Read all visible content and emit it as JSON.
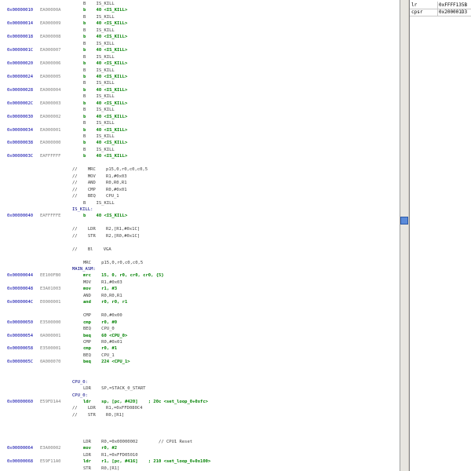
{
  "registers": [
    {
      "name": "lr",
      "value": "0xFFFF135B"
    },
    {
      "name": "cpsr",
      "value": "0x200001D3"
    }
  ],
  "lines": [
    {
      "row": 0,
      "text": "B    IS_KILL"
    },
    {
      "row": 1,
      "addr": "0x00000010",
      "op": "EA00000A",
      "text": "b    40 <IS_KILL>",
      "hl": true
    },
    {
      "row": 2,
      "text": "B    IS_KILL"
    },
    {
      "row": 3,
      "addr": "0x00000014",
      "op": "EA000009",
      "text": "b    40 <IS_KILL>",
      "hl": true
    },
    {
      "row": 4,
      "text": "B    IS_KILL"
    },
    {
      "row": 5,
      "addr": "0x00000018",
      "op": "EA000008",
      "text": "b    40 <IS_KILL>",
      "hl": true
    },
    {
      "row": 6,
      "text": "B    IS_KILL"
    },
    {
      "row": 7,
      "addr": "0x0000001C",
      "op": "EA000007",
      "text": "b    40 <IS_KILL>",
      "hl": true
    },
    {
      "row": 8,
      "text": "B    IS_KILL"
    },
    {
      "row": 9,
      "addr": "0x00000020",
      "op": "EA000006",
      "text": "b    40 <IS_KILL>",
      "hl": true
    },
    {
      "row": 10,
      "text": "B    IS_KILL"
    },
    {
      "row": 11,
      "addr": "0x00000024",
      "op": "EA000005",
      "text": "b    40 <IS_KILL>",
      "hl": true
    },
    {
      "row": 12,
      "text": "B    IS_KILL"
    },
    {
      "row": 13,
      "addr": "0x00000028",
      "op": "EA000004",
      "text": "b    40 <IS_KILL>",
      "hl": true
    },
    {
      "row": 14,
      "text": "B    IS_KILL"
    },
    {
      "row": 15,
      "addr": "0x0000002C",
      "op": "EA000003",
      "text": "b    40 <IS_KILL>",
      "hl": true
    },
    {
      "row": 16,
      "text": "B    IS_KILL"
    },
    {
      "row": 17,
      "addr": "0x00000030",
      "op": "EA000002",
      "text": "b    40 <IS_KILL>",
      "hl": true
    },
    {
      "row": 18,
      "text": "B    IS_KILL"
    },
    {
      "row": 19,
      "addr": "0x00000034",
      "op": "EA000001",
      "text": "b    40 <IS_KILL>",
      "hl": true
    },
    {
      "row": 20,
      "text": "B    IS_KILL"
    },
    {
      "row": 21,
      "addr": "0x00000038",
      "op": "EA000000",
      "text": "b    40 <IS_KILL>",
      "hl": true
    },
    {
      "row": 22,
      "text": "B    IS_KILL"
    },
    {
      "row": 23,
      "addr": "0x0000003C",
      "op": "EAFFFFFF",
      "text": "b    40 <IS_KILL>",
      "hl": true
    },
    {
      "row": 25,
      "text": "//    MRC    p15,0,r0,c0,c0,5",
      "ind": -1
    },
    {
      "row": 26,
      "text": "//    MOV    R1,#0x03",
      "ind": -1
    },
    {
      "row": 27,
      "text": "//    AND    R0,R0,R1",
      "ind": -1
    },
    {
      "row": 28,
      "text": "//    CMP    R0,#0x01",
      "ind": -1
    },
    {
      "row": 29,
      "text": "//    BEQ    CPU_1",
      "ind": -1
    },
    {
      "row": 30,
      "text": "B    IS_KILL"
    },
    {
      "row": 31,
      "text": "IS_KILL:",
      "lbl": true,
      "ind": -2
    },
    {
      "row": 32,
      "addr": "0x00000040",
      "op": "EAFFFFFE",
      "text": "b    40 <IS_KILL>",
      "hl": true
    },
    {
      "row": 34,
      "text": "//    LDR    R2,[R1,#0x1C]",
      "ind": -1
    },
    {
      "row": 35,
      "text": "//    STR    R2,[R0,#0x1C]",
      "ind": -1
    },
    {
      "row": 37,
      "text": "//    Bl    VGA",
      "ind": -1
    },
    {
      "row": 39,
      "text": "MRC    p15,0,r0,c0,c0,5"
    },
    {
      "row": 40,
      "text": "MAIN_ASM:",
      "lbl": true,
      "ind": -2
    },
    {
      "row": 41,
      "addr": "0x00000044",
      "op": "EE100FB0",
      "text": "mrc    15, 0, r0, cr0, cr0, {5}",
      "hl": true
    },
    {
      "row": 42,
      "text": "MOV    R1,#0x03"
    },
    {
      "row": 43,
      "addr": "0x00000048",
      "op": "E3A01003",
      "text": "mov    r1, #3",
      "hl": true
    },
    {
      "row": 44,
      "text": "AND    R0,R0,R1"
    },
    {
      "row": 45,
      "addr": "0x0000004C",
      "op": "E0000001",
      "text": "and    r0, r0, r1",
      "hl": true
    },
    {
      "row": 47,
      "text": "CMP    R0,#0x00"
    },
    {
      "row": 48,
      "addr": "0x00000050",
      "op": "E3500000",
      "text": "cmp    r0, #0",
      "hl": true
    },
    {
      "row": 49,
      "text": "BEQ    CPU_0"
    },
    {
      "row": 50,
      "addr": "0x00000054",
      "op": "0A000001",
      "text": "beq    60 <CPU_0>",
      "hl": true
    },
    {
      "row": 51,
      "text": "CMP    R0,#0x01"
    },
    {
      "row": 52,
      "addr": "0x00000058",
      "op": "E3500001",
      "text": "cmp    r0, #1",
      "hl": true
    },
    {
      "row": 53,
      "text": "BEQ    CPU_1"
    },
    {
      "row": 54,
      "addr": "0x0000005C",
      "op": "0A000070",
      "text": "beq    224 <CPU_1>",
      "hl": true
    },
    {
      "row": 57,
      "text": "CPU_0:",
      "lbl": true,
      "ind": -2
    },
    {
      "row": 58,
      "text": "LDR    SP,=STACK_0_START"
    },
    {
      "row": 59,
      "text": "CPU_0:",
      "lbl": true,
      "ind": -2
    },
    {
      "row": 60,
      "addr": "0x00000060",
      "op": "E59FD1A4",
      "text": "ldr    sp, [pc, #420]    ; 20c <set_loop_0+0xfc>",
      "hl": true
    },
    {
      "row": 61,
      "text": "//    LDR    R1,=0xFFD080C4",
      "ind": -1
    },
    {
      "row": 62,
      "text": "//    STR    R0,[R1]",
      "ind": -1
    },
    {
      "row": 66,
      "text": "LDR    R0,=0x00000002        // CPU1 Reset"
    },
    {
      "row": 67,
      "addr": "0x00000064",
      "op": "E3A00002",
      "text": "mov    r0, #2",
      "hl": true
    },
    {
      "row": 68,
      "text": "LDR    R1,=0xFFD05010"
    },
    {
      "row": 69,
      "addr": "0x00000068",
      "op": "E59F11A0",
      "text": "ldr    r1, [pc, #416]    ; 210 <set_loop_0+0x100>",
      "hl": true
    },
    {
      "row": 70,
      "text": "STR    R0,[R1]"
    }
  ]
}
